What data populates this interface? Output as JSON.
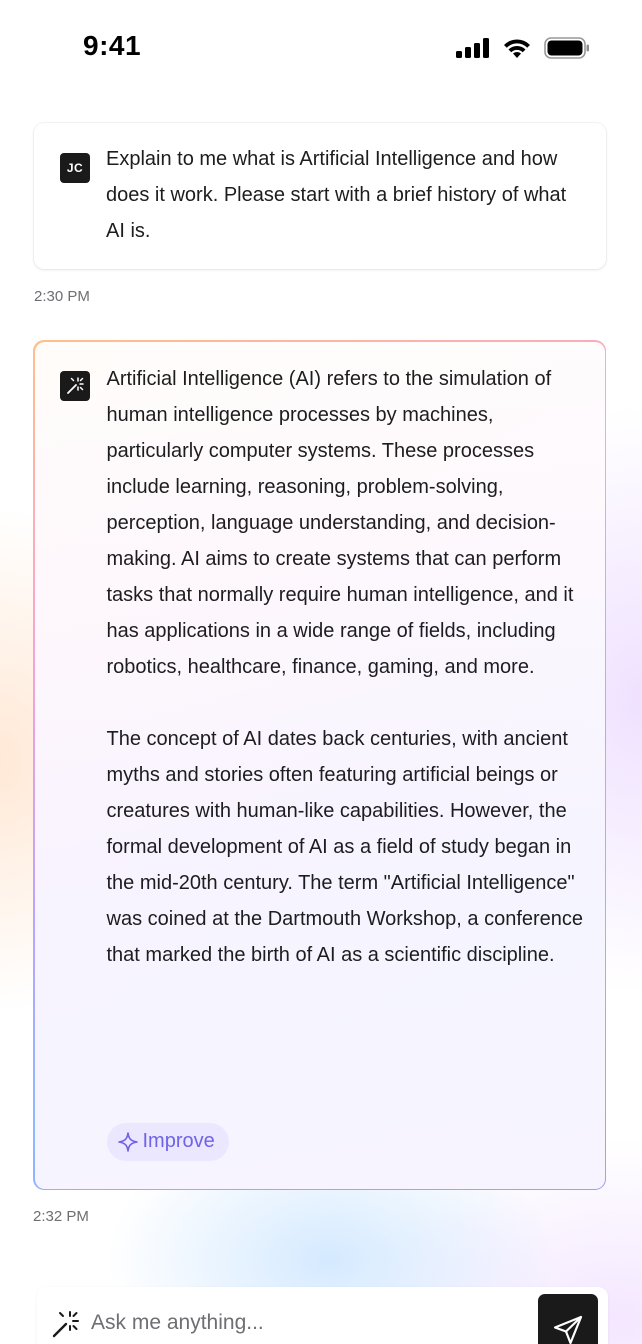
{
  "status_bar": {
    "time": "9:41",
    "icons": [
      "signal-icon",
      "wifi-icon",
      "battery-icon"
    ]
  },
  "conversation": {
    "user_message": {
      "avatar_initials": "JC",
      "text": "Explain to me what is Artificial Intelligence and how does it work. Please start with a brief history of what AI is.",
      "timestamp": "2:30 PM"
    },
    "ai_message": {
      "avatar_icon": "sparkle-wand-icon",
      "paragraphs": [
        "Artificial Intelligence (AI) refers to the simulation of human intelligence processes by machines, particularly computer systems. These processes include learning, reasoning, problem-solving, perception, language understanding, and decision-making. AI aims to create systems that can perform tasks that normally require human intelligence, and it has applications in a wide range of fields, including robotics, healthcare, finance, gaming, and more.",
        "The concept of AI dates back centuries, with ancient myths and stories often featuring artificial beings or creatures with human-like capabilities. However, the formal development of AI as a field of study began in the mid-20th century. The term \"Artificial Intelligence\" was coined at the Dartmouth Workshop, a conference that marked the birth of AI as a scientific discipline."
      ],
      "improve_label": "Improve",
      "timestamp": "2:32 PM"
    }
  },
  "input_bar": {
    "placeholder": "Ask me anything...",
    "send_icon": "send-icon"
  },
  "colors": {
    "accent": "#6f63e6",
    "improve_bg": "#ebe7ff",
    "dark": "#1a1a1a"
  }
}
